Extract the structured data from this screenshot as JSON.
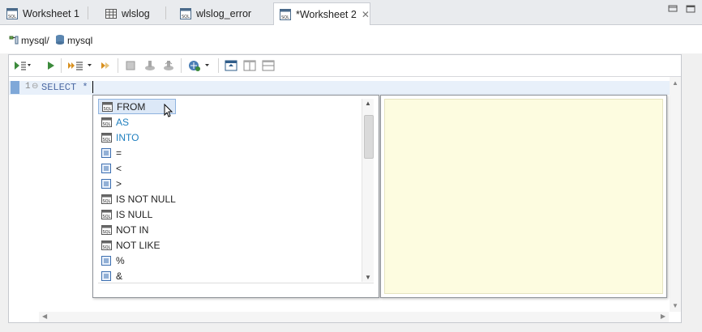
{
  "tabs": [
    {
      "label": "Worksheet 1",
      "icon": "sql-worksheet-icon"
    },
    {
      "label": "wlslog",
      "icon": "table-icon"
    },
    {
      "label": "wlslog_error",
      "icon": "sql-worksheet-icon"
    },
    {
      "label": "*Worksheet 2",
      "icon": "sql-worksheet-icon",
      "active": true
    }
  ],
  "connection": {
    "path": "mysql/",
    "database": "mysql"
  },
  "editor": {
    "line_number": "1",
    "code": "SELECT *"
  },
  "completion": {
    "items": [
      {
        "label": "FROM",
        "kind": "sql-keyword",
        "selected": true
      },
      {
        "label": "AS",
        "kind": "sql-keyword"
      },
      {
        "label": "INTO",
        "kind": "sql-keyword"
      },
      {
        "label": "=",
        "kind": "operator"
      },
      {
        "label": "<",
        "kind": "operator"
      },
      {
        "label": ">",
        "kind": "operator"
      },
      {
        "label": "IS NOT NULL",
        "kind": "sql-keyword"
      },
      {
        "label": "IS NULL",
        "kind": "sql-keyword"
      },
      {
        "label": "NOT IN",
        "kind": "sql-keyword"
      },
      {
        "label": "NOT LIKE",
        "kind": "sql-keyword"
      },
      {
        "label": "%",
        "kind": "operator"
      },
      {
        "label": "&",
        "kind": "operator"
      }
    ]
  },
  "colors": {
    "keyword_blue": "#1f7fbf",
    "doc_background": "#fdfce0",
    "selection": "#dce8f7"
  }
}
